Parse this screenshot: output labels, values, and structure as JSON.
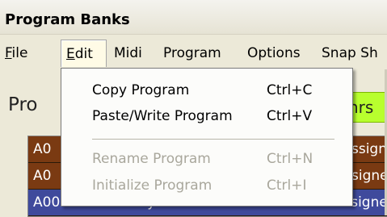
{
  "window": {
    "title": "Program Banks"
  },
  "menubar": {
    "items": [
      {
        "label": "File",
        "accel": "F",
        "rest": "ile"
      },
      {
        "label": "Edit",
        "accel": "E",
        "rest": "dit"
      },
      {
        "label": "Midi"
      },
      {
        "label": "Program"
      },
      {
        "label": "Options"
      },
      {
        "label": "Snap Sh"
      }
    ]
  },
  "edit_menu": {
    "copy": {
      "label": "Copy Program",
      "shortcut": "Ctrl+C"
    },
    "paste": {
      "label": "Paste/Write Program",
      "shortcut": "Ctrl+V"
    },
    "rename": {
      "label": "Rename Program",
      "shortcut": "Ctrl+N"
    },
    "initialize": {
      "label": "Initialize Program",
      "shortcut": "Ctrl+I"
    }
  },
  "main": {
    "program_label": "Pro",
    "green_button": "nrs"
  },
  "table": {
    "rows": [
      {
        "id": "A0",
        "name": "",
        "status": "ssigne"
      },
      {
        "id": "A0",
        "name": "",
        "status": "signe"
      },
      {
        "id": "A003",
        "name": "P5-3-2 sync",
        "status": "- Not Assigne"
      }
    ]
  },
  "colors": {
    "row_brown": "#7a3a12",
    "row_blue": "#3f4a9c",
    "green_button": "#b8ff2e",
    "menu_bg": "#ece9d8"
  }
}
